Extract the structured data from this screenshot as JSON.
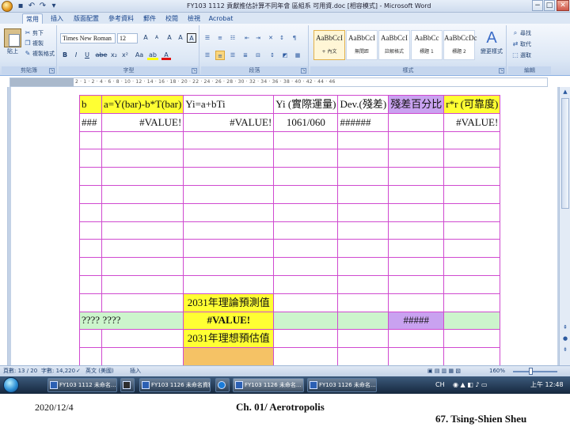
{
  "window": {
    "title": "FY103 1112 貢獻推估計算不同年會 區組系 可用資.doc [相容模式] - Microsoft Word",
    "buttons": {
      "minimize": "−",
      "maximize": "□",
      "close": "✕"
    },
    "quick_access": [
      "save-icon",
      "undo-icon",
      "redo-icon",
      "customize-icon"
    ]
  },
  "ribbon": {
    "tabs": [
      "常用",
      "插入",
      "版面配置",
      "參考資料",
      "郵件",
      "校閱",
      "檢視",
      "Acrobat"
    ],
    "active_tab": "常用",
    "clipboard": {
      "label": "剪貼簿",
      "paste": "貼上",
      "cut": "剪下",
      "copy": "複製",
      "format_painter": "複製格式"
    },
    "font": {
      "label": "字型",
      "name": "Times New Roman",
      "size": "12",
      "bold": "B",
      "italic": "I",
      "underline": "U",
      "strike": "abe",
      "subscript": "x₂",
      "superscript": "x²",
      "case": "Aa",
      "highlight": "ab",
      "color": "A",
      "grow": "A",
      "shrink": "A",
      "clear": "A",
      "phonetic": "A",
      "border": "A"
    },
    "paragraph": {
      "label": "段落"
    },
    "styles": {
      "label": "樣式",
      "items": [
        {
          "sample": "AaBbCcI",
          "name": "+ 內文"
        },
        {
          "sample": "AaBbCcI",
          "name": "無間距"
        },
        {
          "sample": "AaBbCcI",
          "name": "註解格式"
        },
        {
          "sample": "AaBbCc",
          "name": "標題 1"
        },
        {
          "sample": "AaBbCcDc",
          "name": "標題 2"
        }
      ],
      "change_styles": "變更樣式"
    },
    "editing": {
      "label": "編輯",
      "find": "尋找",
      "replace": "取代",
      "select": "選取"
    }
  },
  "ruler": {
    "marks": "2 · 1 · 2 · 4 · 6 · 8 · 10 · 12 · 14 · 16 · 18 · 20 · 22 · 24 · 26 · 28 · 30 · 32 · 34 · 36 · 38 · 40 · 42 · 44 · 46"
  },
  "table": {
    "header": [
      "b",
      "a=Y(bar)-b*T(bar)",
      "Yi=a+bTi",
      "Yi (實際運量)",
      "Dev.(殘差)",
      "殘差百分比",
      "r*r (可靠度)"
    ],
    "row1": [
      "###",
      "#VALUE!",
      "#VALUE!",
      "1061/060",
      "######",
      "",
      "#VALUE!"
    ],
    "forecast_label": "2031年理論預測值",
    "forecast_row": [
      "???? ????",
      "#VALUE!",
      "#####"
    ],
    "estimate_label": "2031年理想預估值"
  },
  "statusbar": {
    "page": "頁數: 13 / 20",
    "words": "字數: 14,220",
    "language": "英文 (美國)",
    "mode": "插入",
    "zoom": "160%"
  },
  "taskbar": {
    "buttons": [
      "FY103 1112 未命名...",
      "FY103 1126 未命名資料",
      "FY103 1126 未命名...",
      "FY103 1126 未命名..."
    ],
    "tray_lang": "CH",
    "clock": "上午 12:48"
  },
  "footer": {
    "date": "2020/12/4",
    "center": "Ch. 01/ Aerotropolis",
    "right": "67. Tsing-Shien Sheu"
  }
}
